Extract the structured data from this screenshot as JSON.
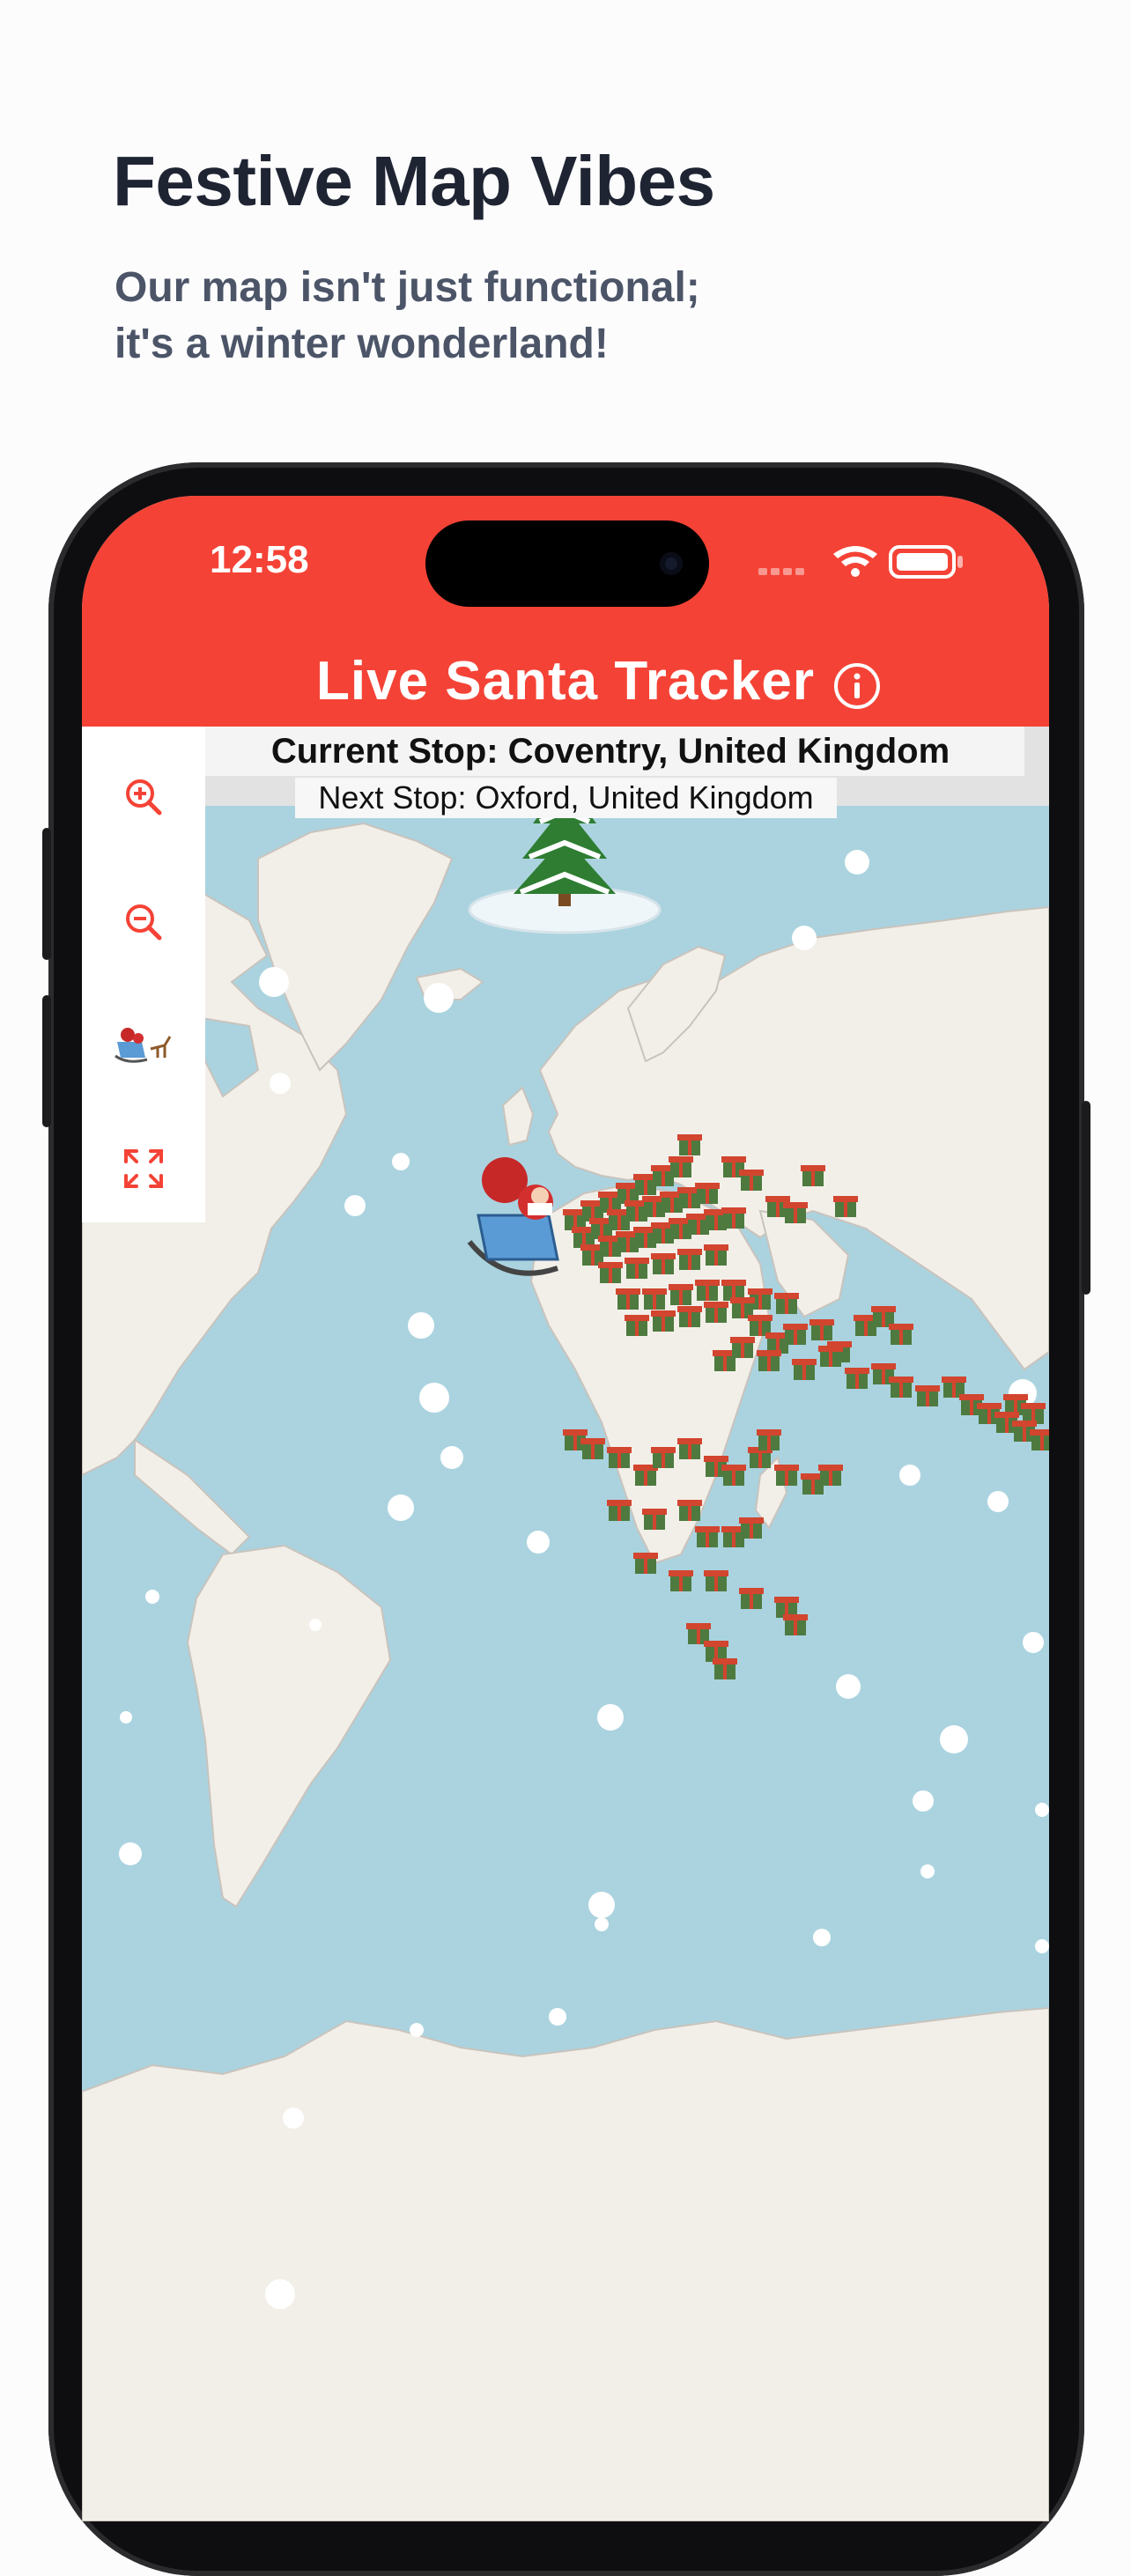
{
  "page": {
    "headline": "Festive Map Vibes",
    "subline_1": "Our map isn't just functional;",
    "subline_2": "it's a winter wonderland!"
  },
  "status_bar": {
    "time": "12:58"
  },
  "app": {
    "title": "Live Santa Tracker",
    "current_stop": "Current Stop: Coventry, United Kingdom",
    "next_stop": "Next Stop: Oxford, United Kingdom"
  },
  "controls": {
    "items": [
      {
        "name": "zoom-in-button",
        "icon": "zoom-in-icon"
      },
      {
        "name": "zoom-out-button",
        "icon": "zoom-out-icon"
      },
      {
        "name": "follow-santa-button",
        "icon": "sleigh-icon"
      },
      {
        "name": "fullscreen-button",
        "icon": "expand-icon"
      }
    ]
  },
  "colors": {
    "accent": "#f44336",
    "ocean": "#aad3df",
    "land": "#f2efe9",
    "gift_box": "#4e7a3f",
    "gift_ribbon": "#d2452f"
  }
}
